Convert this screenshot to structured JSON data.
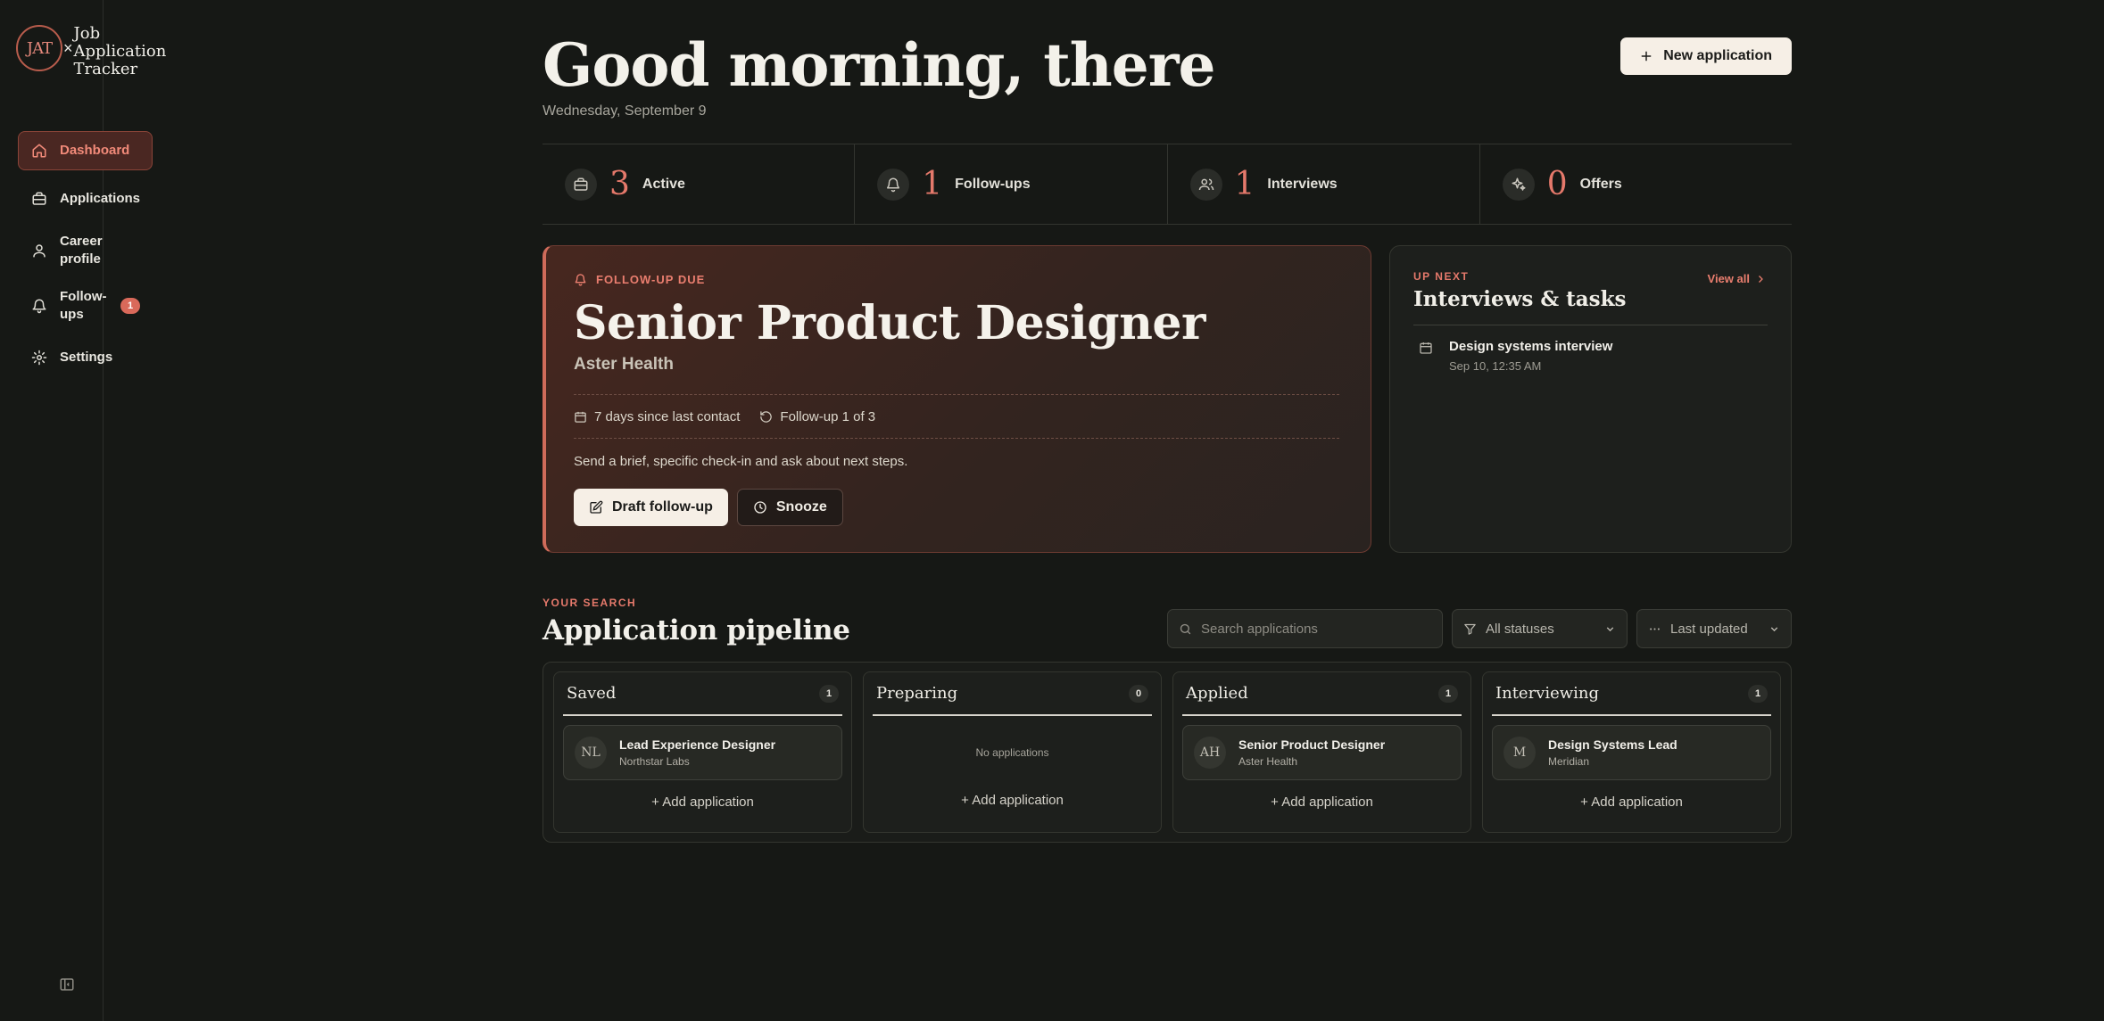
{
  "brand": {
    "logo": "JAT",
    "separator": "×",
    "name": "Job\nApplication\nTracker"
  },
  "nav": {
    "items": [
      {
        "label": "Dashboard",
        "icon": "home-icon"
      },
      {
        "label": "Applications",
        "icon": "briefcase-icon"
      },
      {
        "label": "Career profile",
        "icon": "user-icon"
      },
      {
        "label": "Follow-ups",
        "icon": "bell-icon",
        "badge": "1"
      },
      {
        "label": "Settings",
        "icon": "gear-icon"
      }
    ]
  },
  "header": {
    "greeting": "Good morning, there",
    "date": "Wednesday, September 9",
    "new_button": "New application"
  },
  "stats": [
    {
      "value": "3",
      "label": "Active",
      "icon": "briefcase-icon"
    },
    {
      "value": "1",
      "label": "Follow-ups",
      "icon": "bell-icon"
    },
    {
      "value": "1",
      "label": "Interviews",
      "icon": "users-icon"
    },
    {
      "value": "0",
      "label": "Offers",
      "icon": "sparkle-icon"
    }
  ],
  "focus": {
    "tag": "FOLLOW-UP DUE",
    "title": "Senior Product Designer",
    "company": "Aster Health",
    "days_since": "7 days since last contact",
    "followup_count": "Follow-up 1 of 3",
    "hint": "Send a brief, specific check-in and ask about next steps.",
    "draft_button": "Draft follow-up",
    "snooze_button": "Snooze"
  },
  "upnext": {
    "kicker": "UP NEXT",
    "title": "Interviews & tasks",
    "view_all": "View all",
    "items": [
      {
        "title": "Design systems interview",
        "time": "Sep 10, 12:35 AM"
      }
    ]
  },
  "pipeline": {
    "kicker": "YOUR SEARCH",
    "title": "Application pipeline",
    "search_placeholder": "Search applications",
    "status_filter": "All statuses",
    "sort": "Last updated",
    "add_label": "Add application",
    "empty_label": "No applications",
    "columns": [
      {
        "name": "Saved",
        "count": "1",
        "cards": [
          {
            "initials": "NL",
            "title": "Lead Experience Designer",
            "company": "Northstar Labs"
          }
        ]
      },
      {
        "name": "Preparing",
        "count": "0",
        "cards": []
      },
      {
        "name": "Applied",
        "count": "1",
        "cards": [
          {
            "initials": "AH",
            "title": "Senior Product Designer",
            "company": "Aster Health"
          }
        ]
      },
      {
        "name": "Interviewing",
        "count": "1",
        "cards": [
          {
            "initials": "M",
            "title": "Design Systems Lead",
            "company": "Meridian"
          }
        ]
      }
    ]
  },
  "colors": {
    "accent": "#e5796b",
    "background": "#161815",
    "card_button": "#f6efe6"
  }
}
